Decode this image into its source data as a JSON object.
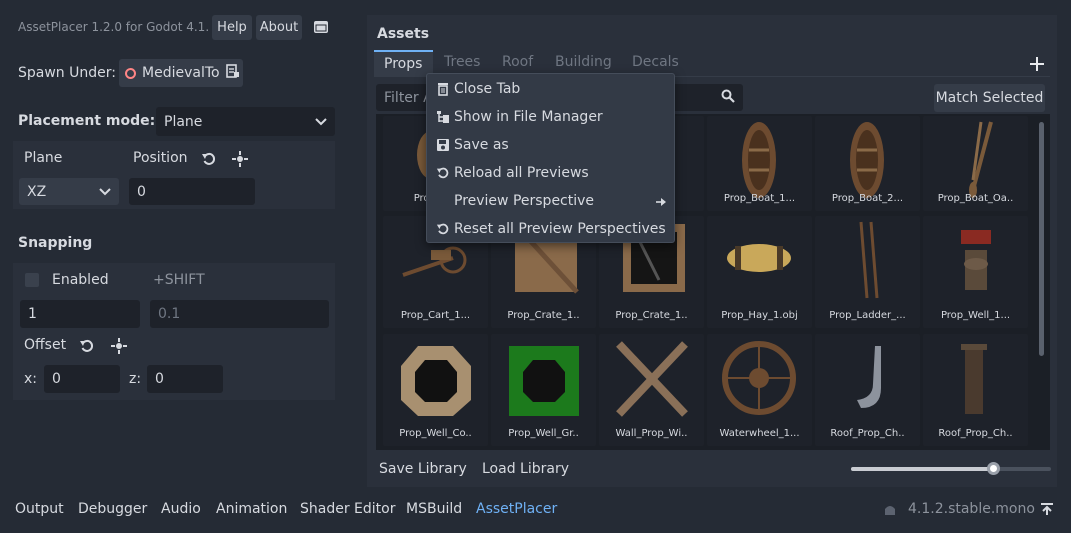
{
  "header": {
    "title": "AssetPlacer 1.2.0 for Godot 4.1.",
    "help": "Help",
    "about": "About"
  },
  "spawn": {
    "label": "Spawn Under:",
    "value": "MedievalTo"
  },
  "placement": {
    "label": "Placement mode:",
    "value": "Plane"
  },
  "plane": {
    "label": "Plane",
    "position_label": "Position",
    "axis": "XZ",
    "position_value": "0"
  },
  "snapping": {
    "title": "Snapping",
    "enabled": "Enabled",
    "shift": "+SHIFT",
    "step": "1",
    "shift_step": "0.1",
    "offset": "Offset",
    "x_label": "x:",
    "x_value": "0",
    "z_label": "z:",
    "z_value": "0"
  },
  "assets": {
    "title": "Assets",
    "tabs": [
      "Props",
      "Trees",
      "Roof",
      "Building",
      "Decals"
    ],
    "filter_placeholder": "Filter A",
    "match_selected": "Match Selected",
    "items": [
      "Prop_B...",
      "",
      "",
      "Prop_Boat_1...",
      "Prop_Boat_2...",
      "Prop_Boat_Oa..",
      "Prop_Cart_1...",
      "Prop_Crate_1..",
      "Prop_Crate_1..",
      "Prop_Hay_1.obj",
      "Prop_Ladder_...",
      "Prop_Well_1...",
      "Prop_Well_Co..",
      "Prop_Well_Gr..",
      "Wall_Prop_Wi..",
      "Waterwheel_1...",
      "Roof_Prop_Ch..",
      "Roof_Prop_Ch.."
    ],
    "save_library": "Save Library",
    "load_library": "Load Library",
    "zoom_level": 0.71
  },
  "context_menu": {
    "items": [
      "Close Tab",
      "Show in File Manager",
      "Save as",
      "Reload all Previews",
      "Preview Perspective",
      "Reset all Preview Perspectives"
    ]
  },
  "bottom": {
    "tabs": [
      "Output",
      "Debugger",
      "Audio",
      "Animation",
      "Shader Editor",
      "MSBuild",
      "AssetPlacer"
    ],
    "version": "4.1.2.stable.mono"
  },
  "colors": {
    "accent": "#6fb1f5",
    "bg": "#252b35",
    "panel": "#2a303b",
    "field": "#1e222a",
    "node_icon": "#ff8585"
  }
}
